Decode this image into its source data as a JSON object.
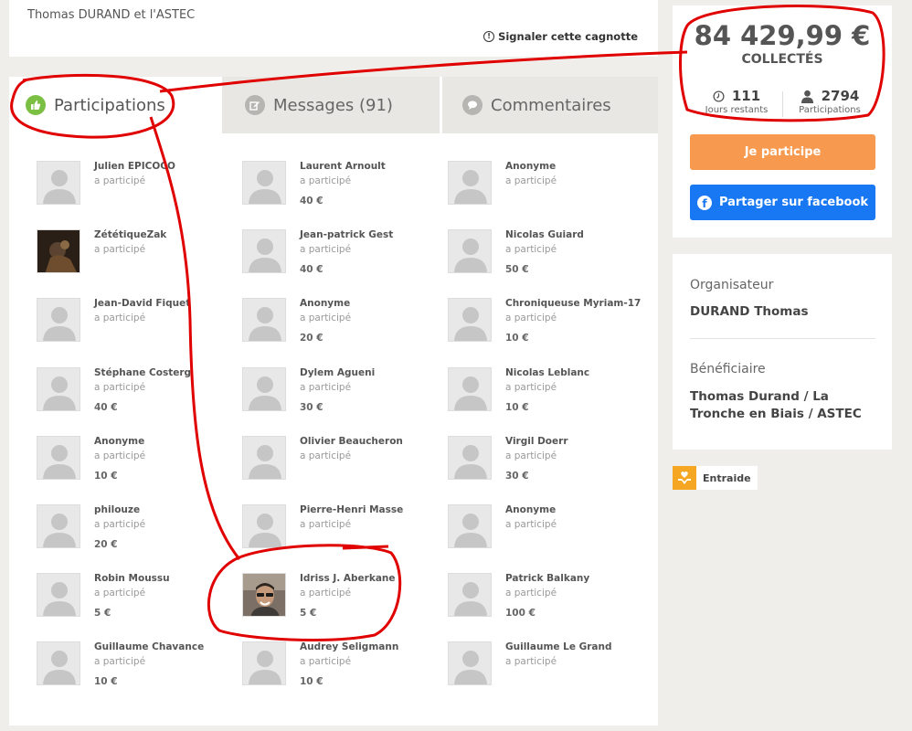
{
  "header": {
    "title": "Thomas DURAND et l'ASTEC",
    "report_label": "Signaler cette cagnotte"
  },
  "tabs": [
    {
      "label": "Participations",
      "icon": "thumbs-up-icon",
      "active": true
    },
    {
      "label": "Messages (91)",
      "icon": "edit-icon",
      "active": false
    },
    {
      "label": "Commentaires",
      "icon": "speech-bubble-icon",
      "active": false
    }
  ],
  "participant_status": "a participé",
  "columns": [
    [
      {
        "name": "Julien EPICOCO",
        "amount": ""
      },
      {
        "name": "ZététiqueZak",
        "amount": "",
        "photo": true
      },
      {
        "name": "Jean-David Fiquet",
        "amount": ""
      },
      {
        "name": "Stéphane Costerg",
        "amount": "40 €"
      },
      {
        "name": "Anonyme",
        "amount": "10 €"
      },
      {
        "name": "philouze",
        "amount": "20 €"
      },
      {
        "name": "Robin Moussu",
        "amount": "5 €"
      },
      {
        "name": "Guillaume Chavance",
        "amount": "10 €"
      }
    ],
    [
      {
        "name": "Laurent Arnoult",
        "amount": "40 €"
      },
      {
        "name": "Jean-patrick Gest",
        "amount": "40 €"
      },
      {
        "name": "Anonyme",
        "amount": "20 €"
      },
      {
        "name": "Dylem Agueni",
        "amount": "30 €"
      },
      {
        "name": "Olivier Beaucheron",
        "amount": ""
      },
      {
        "name": "Pierre-Henri Masse",
        "amount": ""
      },
      {
        "name": "Idriss J. Aberkane",
        "amount": "5 €",
        "photo": true
      },
      {
        "name": "Audrey Seligmann",
        "amount": "10 €"
      }
    ],
    [
      {
        "name": "Anonyme",
        "amount": ""
      },
      {
        "name": "Nicolas Guiard",
        "amount": "50 €"
      },
      {
        "name": "Chroniqueuse Myriam-17",
        "amount": "10 €"
      },
      {
        "name": "Nicolas Leblanc",
        "amount": "10 €"
      },
      {
        "name": "Virgil Doerr",
        "amount": "30 €"
      },
      {
        "name": "Anonyme",
        "amount": ""
      },
      {
        "name": "Patrick Balkany",
        "amount": "100 €"
      },
      {
        "name": "Guillaume Le Grand",
        "amount": ""
      }
    ]
  ],
  "summary": {
    "amount": "84 429,99 €",
    "collected_label": "COLLECTÉS",
    "days_value": "111",
    "days_label": "Jours restants",
    "participants_value": "2794",
    "participants_label": "Participations",
    "participate_button": "Je participe",
    "facebook_button": "Partager sur facebook"
  },
  "organizer": {
    "organizer_label": "Organisateur",
    "organizer_name": "DURAND Thomas",
    "beneficiary_label": "Bénéficiaire",
    "beneficiary_name": "Thomas Durand / La Tronche en Biais / ASTEC"
  },
  "category_tag": "Entraide",
  "colors": {
    "participate": "#f79a4f",
    "facebook": "#1877f2",
    "annotation": "#e00000",
    "active_tab_icon": "#7bc043"
  }
}
